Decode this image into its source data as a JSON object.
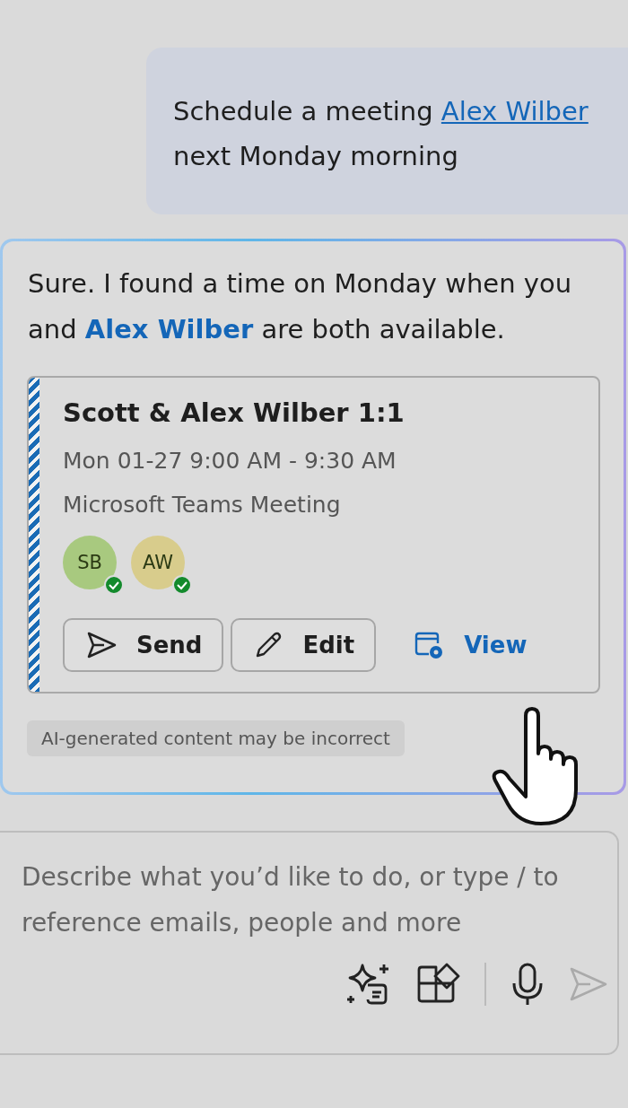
{
  "user_message": {
    "text_before": "Schedule a meeting ",
    "link": "Alex Wilber",
    "text_after": " next Monday morning"
  },
  "assistant_message": {
    "text": "Sure. I found a time on Monday when you and **Alex Wilber** are both available.",
    "event": {
      "title": "Scott & Alex Wilber 1:1",
      "time": "Mon 01-27 9:00 AM - 9:30 AM",
      "location": "Microsoft Teams Meeting",
      "attendees": [
        {
          "initials": "SB",
          "color": "#a8c97f",
          "available": true
        },
        {
          "initials": "AW",
          "color": "#d8cc8c",
          "available": true
        }
      ],
      "actions": [
        {
          "kind": "send",
          "label": "Send"
        },
        {
          "kind": "edit",
          "label": "Edit"
        },
        {
          "kind": "view",
          "label": "View"
        }
      ]
    },
    "disclaimer": "AI-generated content may be incorrect"
  },
  "composer": {
    "placeholder": "Describe what you’d like to do, or type / to reference emails, people and more",
    "send_disabled": true
  }
}
